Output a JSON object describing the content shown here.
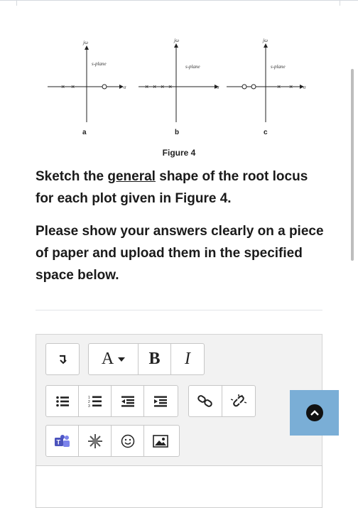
{
  "figure": {
    "axis_label": "jω",
    "sigma_label": "σ",
    "plane_label": "s-plane",
    "plots": [
      "a",
      "b",
      "c"
    ],
    "caption": "Figure 4"
  },
  "question": {
    "part1_before": "Sketch the ",
    "part1_underlined": "general",
    "part1_after": " shape of the root locus for each plot given in Figure 4.",
    "part2": "Please show your answers clearly on a piece of paper and upload them in the specified space below."
  },
  "toolbar": {
    "paragraph_icon": "paragraph-icon",
    "font_label": "A",
    "bold_label": "B",
    "italic_label": "I",
    "row2_icons": [
      "unordered-list-icon",
      "ordered-list-icon",
      "outdent-icon",
      "indent-icon",
      "link-icon",
      "unlink-icon"
    ],
    "row3_icons": [
      "teams-icon",
      "media-icon",
      "emoji-icon",
      "image-icon"
    ]
  },
  "colors": {
    "scroll_button": "#7aaed6",
    "editor_background": "#f2f2f2"
  }
}
